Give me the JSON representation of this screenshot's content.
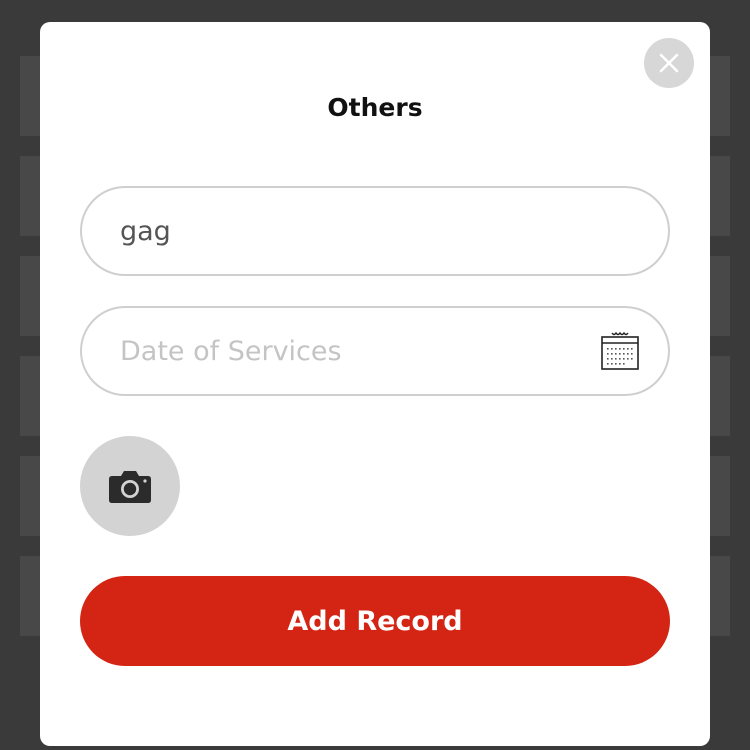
{
  "dialog": {
    "title": "Others",
    "close_icon": "close-icon"
  },
  "form": {
    "name_field": {
      "value": "gag"
    },
    "date_field": {
      "placeholder": "Date of Services",
      "icon": "calendar-icon"
    },
    "photo": {
      "icon": "camera-icon"
    },
    "submit_label": "Add Record"
  },
  "colors": {
    "accent": "#d42413",
    "overlay_background": "#3a3a3a",
    "border": "#cfcfcf",
    "placeholder": "#c4c4c4"
  }
}
